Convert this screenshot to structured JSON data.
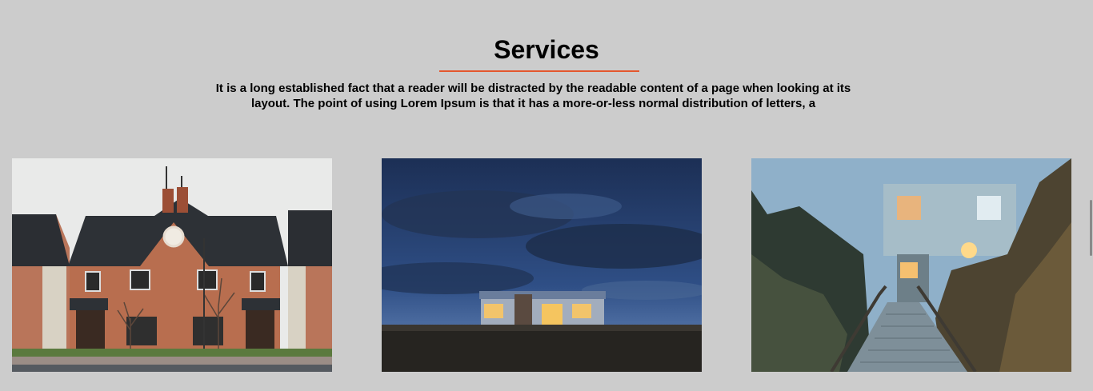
{
  "services": {
    "title": "Services",
    "description": "It is a long established fact that a reader will be distracted by the readable content of a page when looking at its layout. The point of using Lorem Ipsum is that it has a more-or-less normal distribution of letters, a",
    "accent_color": "#e4572e",
    "background_color": "#cccccc",
    "images": [
      {
        "subject": "brick-houses"
      },
      {
        "subject": "night-cabin"
      },
      {
        "subject": "boardwalk-house"
      }
    ]
  }
}
